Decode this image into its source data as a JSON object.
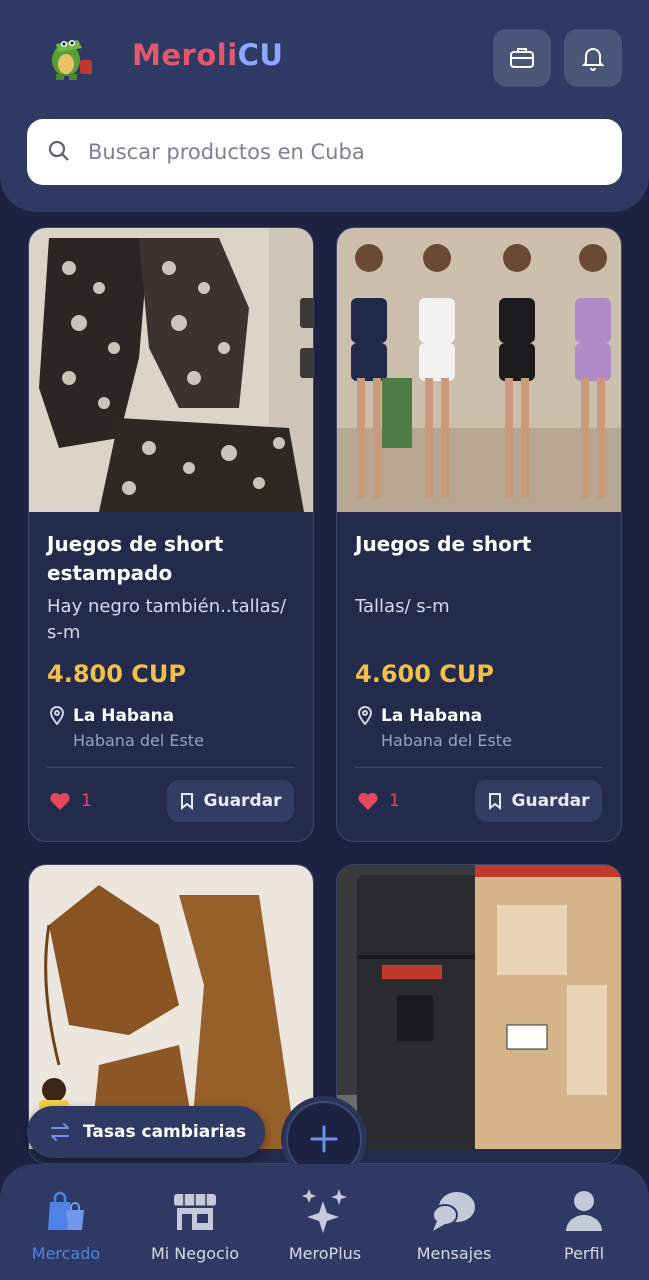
{
  "app": {
    "logo_text_a": "Meroli",
    "logo_text_b": "CU"
  },
  "search": {
    "placeholder": "Buscar productos en Cuba"
  },
  "colors": {
    "accent": "#4e82e6",
    "price": "#f1bf4a",
    "background": "#1b2340",
    "surface": "#2e3a63",
    "like": "#e2475a"
  },
  "products": [
    {
      "title": "Juegos de short estampado",
      "description": "Hay negro también..tallas/ s-m",
      "price": "4.800 CUP",
      "city": "La Habana",
      "area": "Habana del Este",
      "likes": "1",
      "save_label": "Guardar"
    },
    {
      "title": "Juegos de short",
      "description": "Tallas/ s-m",
      "price": "4.600 CUP",
      "city": "La Habana",
      "area": "Habana del Este",
      "likes": "1",
      "save_label": "Guardar"
    }
  ],
  "rates_button": "Tasas cambiarias",
  "nav": [
    {
      "label": "Mercado",
      "icon": "shopping-bags-icon",
      "active": true
    },
    {
      "label": "Mi Negocio",
      "icon": "store-icon",
      "active": false
    },
    {
      "label": "MeroPlus",
      "icon": "sparkles-icon",
      "active": false
    },
    {
      "label": "Mensajes",
      "icon": "chat-icon",
      "active": false
    },
    {
      "label": "Perfil",
      "icon": "user-icon",
      "active": false
    }
  ]
}
